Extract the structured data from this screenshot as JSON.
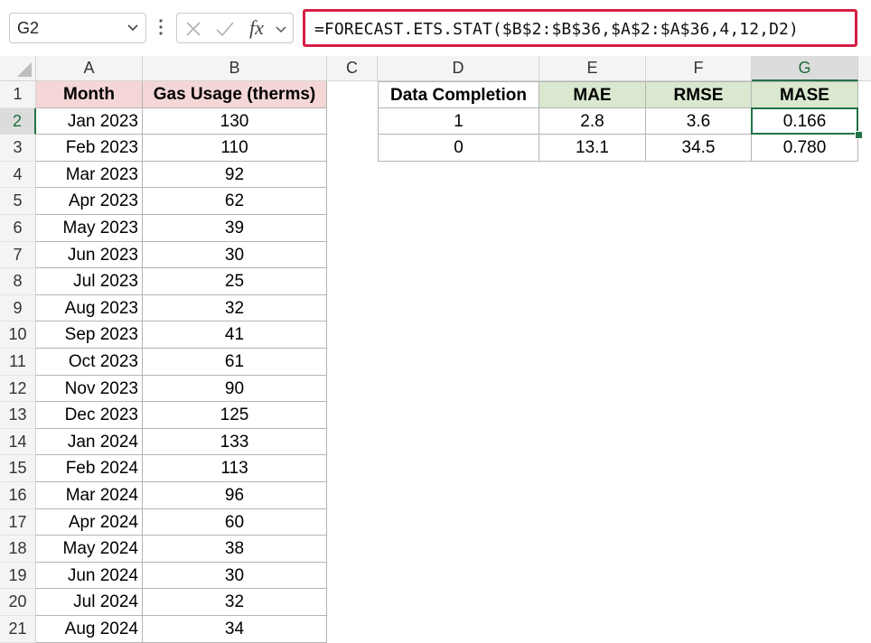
{
  "name_box": {
    "value": "G2"
  },
  "formula_bar": {
    "fx_label": "fx",
    "formula": "=FORECAST.ETS.STAT($B$2:$B$36,$A$2:$A$36,4,12,D2)",
    "highlight_color": "#d41e45"
  },
  "columns": [
    "A",
    "B",
    "C",
    "D",
    "E",
    "F",
    "G"
  ],
  "selected_column": "G",
  "rows": [
    "1",
    "2",
    "3",
    "4",
    "5",
    "6",
    "7",
    "8",
    "9",
    "10",
    "11",
    "12",
    "13",
    "14",
    "15",
    "16",
    "17",
    "18",
    "19",
    "20",
    "21"
  ],
  "selected_row": "2",
  "table_left": {
    "headers": [
      "Month",
      "Gas Usage (therms)"
    ],
    "data": [
      [
        "Jan 2023",
        "130"
      ],
      [
        "Feb 2023",
        "110"
      ],
      [
        "Mar 2023",
        "92"
      ],
      [
        "Apr 2023",
        "62"
      ],
      [
        "May 2023",
        "39"
      ],
      [
        "Jun 2023",
        "30"
      ],
      [
        "Jul 2023",
        "25"
      ],
      [
        "Aug 2023",
        "32"
      ],
      [
        "Sep 2023",
        "41"
      ],
      [
        "Oct 2023",
        "61"
      ],
      [
        "Nov 2023",
        "90"
      ],
      [
        "Dec 2023",
        "125"
      ],
      [
        "Jan 2024",
        "133"
      ],
      [
        "Feb 2024",
        "113"
      ],
      [
        "Mar 2024",
        "96"
      ],
      [
        "Apr 2024",
        "60"
      ],
      [
        "May 2024",
        "38"
      ],
      [
        "Jun 2024",
        "30"
      ],
      [
        "Jul 2024",
        "32"
      ],
      [
        "Aug 2024",
        "34"
      ]
    ]
  },
  "table_right": {
    "headers": [
      "Data Completion",
      "MAE",
      "RMSE",
      "MASE"
    ],
    "data": [
      [
        "1",
        "2.8",
        "3.6",
        "0.166"
      ],
      [
        "0",
        "13.1",
        "34.5",
        "0.780"
      ]
    ]
  },
  "colors": {
    "header_pink": "#f5d6d6",
    "header_green": "#d9e8cf",
    "selection_green": "#217346"
  }
}
